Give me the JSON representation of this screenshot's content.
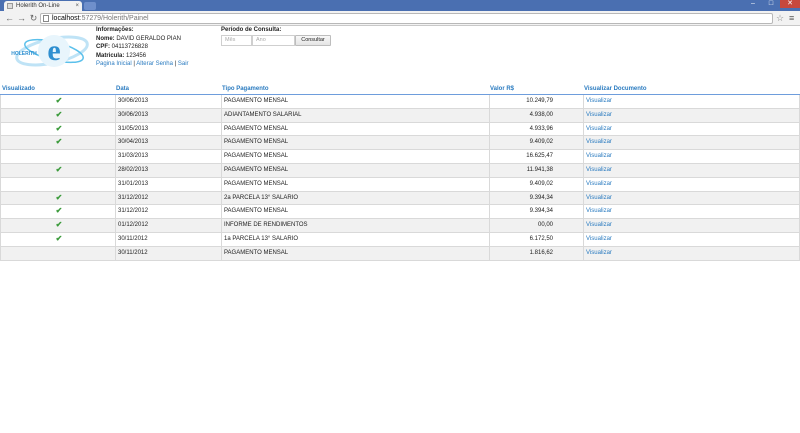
{
  "browser": {
    "tab_title": "Holerith On-Line",
    "tab_close": "×",
    "url_host": "localhost",
    "url_path": ":57279/Holerith/Painel",
    "min": "–",
    "max": "□",
    "close": "✕",
    "back": "←",
    "forward": "→",
    "reload": "↻",
    "star": "☆",
    "menu": "≡"
  },
  "info": {
    "heading": "Informações:",
    "nome_label": "Nome:",
    "nome_value": " DAVID GERALDO PIAN",
    "cpf_label": "CPF:",
    "cpf_value": " 04113726828",
    "matricula_label": "Matricula:",
    "matricula_value": " 123456",
    "links": [
      "Pagina Inicial",
      "Alterar Senha",
      "Sair"
    ],
    "link_sep": " | "
  },
  "periodo": {
    "label": "Período de Consulta:",
    "mes_placeholder": "Mês",
    "ano_placeholder": "Ano",
    "button": "Consultar"
  },
  "table": {
    "headers": [
      "Visualizado",
      "Data",
      "Tipo Pagamento",
      "Valor R$",
      "Visualizar Documento"
    ],
    "link_text": "Visualizar",
    "check_glyph": "✔",
    "rows": [
      {
        "visualizado": true,
        "data": "30/06/2013",
        "tipo": "PAGAMENTO MENSAL",
        "valor": "10.249,79"
      },
      {
        "visualizado": true,
        "data": "30/06/2013",
        "tipo": "ADIANTAMENTO SALARIAL",
        "valor": "4.938,00"
      },
      {
        "visualizado": true,
        "data": "31/05/2013",
        "tipo": "PAGAMENTO MENSAL",
        "valor": "4.933,96"
      },
      {
        "visualizado": true,
        "data": "30/04/2013",
        "tipo": "PAGAMENTO MENSAL",
        "valor": "9.409,02"
      },
      {
        "visualizado": false,
        "data": "31/03/2013",
        "tipo": "PAGAMENTO MENSAL",
        "valor": "16.625,47"
      },
      {
        "visualizado": true,
        "data": "28/02/2013",
        "tipo": "PAGAMENTO MENSAL",
        "valor": "11.941,38"
      },
      {
        "visualizado": false,
        "data": "31/01/2013",
        "tipo": "PAGAMENTO MENSAL",
        "valor": "9.409,02"
      },
      {
        "visualizado": true,
        "data": "31/12/2012",
        "tipo": "2a PARCELA 13° SALARIO",
        "valor": "9.394,34"
      },
      {
        "visualizado": true,
        "data": "31/12/2012",
        "tipo": "PAGAMENTO MENSAL",
        "valor": "9.394,34"
      },
      {
        "visualizado": true,
        "data": "01/12/2012",
        "tipo": "INFORME DE RENDIMENTOS",
        "valor": "00,00"
      },
      {
        "visualizado": true,
        "data": "30/11/2012",
        "tipo": "1a PARCELA 13° SALARIO",
        "valor": "6.172,50"
      },
      {
        "visualizado": false,
        "data": "30/11/2012",
        "tipo": "PAGAMENTO MENSAL",
        "valor": "1.816,62"
      }
    ]
  },
  "logo": {
    "text": "HOLERITH",
    "colors": {
      "primary": "#2f8fd0",
      "light": "#bfe3f6",
      "accent": "#5bc0eb"
    }
  }
}
